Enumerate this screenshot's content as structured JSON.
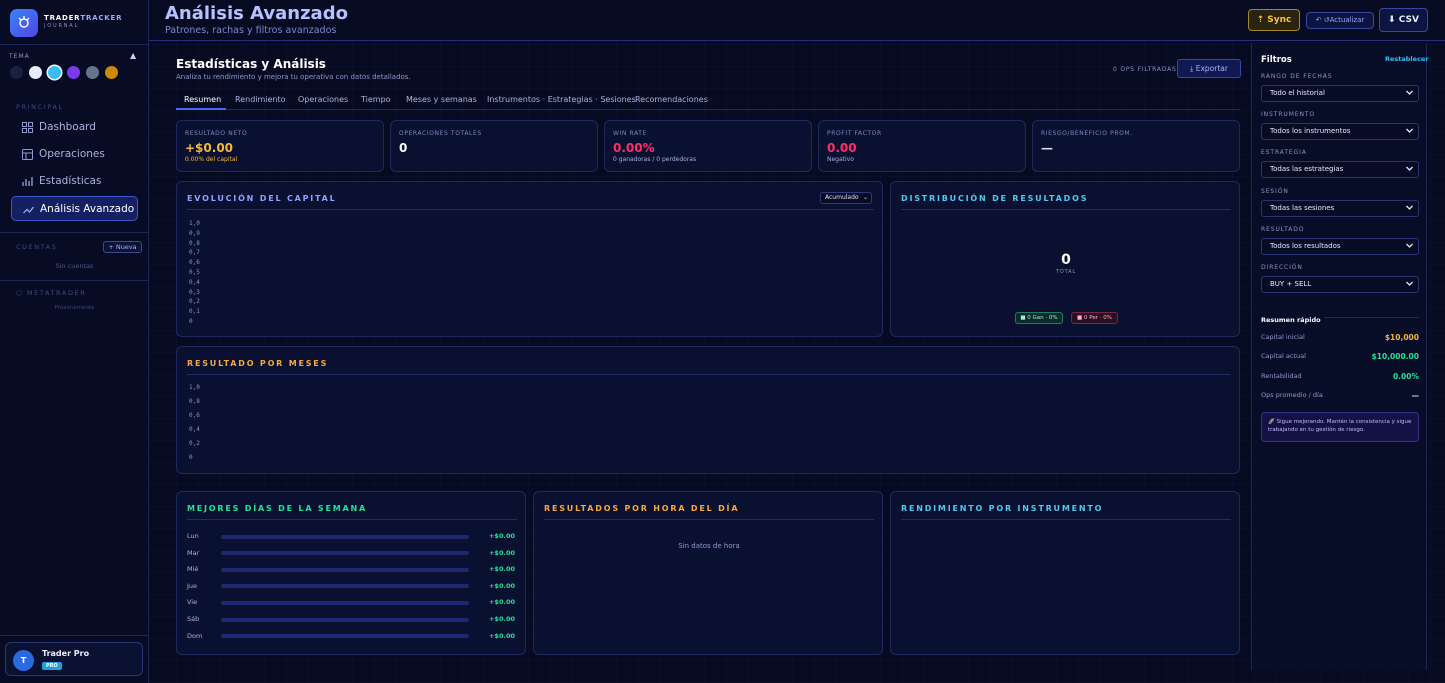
{
  "brand": {
    "name_part1": "TRADER",
    "name_part2": "TRACKER",
    "sub": "JOURNAL"
  },
  "theme": {
    "label": "TEMA",
    "swatches": [
      "#1a2040",
      "#e8ecfa",
      "#38bdf8",
      "#7c3aed",
      "#64748b",
      "#ca8a04"
    ]
  },
  "nav": {
    "section_label": "PRINCIPAL",
    "items": [
      {
        "label": "Dashboard",
        "icon": "grid-icon"
      },
      {
        "label": "Operaciones",
        "icon": "table-icon"
      },
      {
        "label": "Estadísticas",
        "icon": "bar-chart-icon"
      },
      {
        "label": "Análisis Avanzado",
        "icon": "trend-icon",
        "active": true
      }
    ]
  },
  "accounts": {
    "label": "CUENTAS",
    "new_button": "Nueva",
    "empty": "Sin cuentas"
  },
  "metatrader": {
    "label": "METATRADER",
    "sub": "Próximamente"
  },
  "user": {
    "initial": "T",
    "name": "Trader Pro",
    "badge": "PRO"
  },
  "header": {
    "title": "Análisis Avanzado",
    "subtitle": "Patrones, rachas y filtros avanzados",
    "sync": "Sync",
    "refresh": "Actualizar",
    "csv": "CSV"
  },
  "panel": {
    "title": "Estadísticas y Análisis",
    "subtitle": "Analiza tu rendimiento y mejora tu operativa con datos detallados.",
    "ops_filtered": "0 OPS FILTRADAS",
    "export": "Exportar"
  },
  "tabs": [
    "Resumen",
    "Rendimiento",
    "Operaciones",
    "Tiempo",
    "Meses y semanas",
    "Instrumentos · Estrategias · Sesiones",
    "Recomendaciones"
  ],
  "kpis": [
    {
      "label": "RESULTADO NETO",
      "value": "+$0.00",
      "sub": "0.00% del capital",
      "color": "#f5b73b",
      "subcolor": "#f5b73b"
    },
    {
      "label": "OPERACIONES TOTALES",
      "value": "0",
      "sub": "",
      "color": "#ffffff",
      "subcolor": "#8a93c2"
    },
    {
      "label": "WIN RATE",
      "value": "0.00%",
      "sub": "0 ganadoras / 0 perdedoras",
      "color": "#ff2d6b",
      "subcolor": "#a6b0de"
    },
    {
      "label": "PROFIT FACTOR",
      "value": "0.00",
      "sub": "Negativo",
      "color": "#ff2d6b",
      "subcolor": "#a6b0de"
    },
    {
      "label": "RIESGO/BENEFICIO PROM.",
      "value": "—",
      "sub": "",
      "color": "#d7dcf3",
      "subcolor": "#8a93c2"
    }
  ],
  "capital_chart": {
    "title": "EVOLUCIÓN DEL CAPITAL",
    "mode": "Acumulado",
    "yticks": [
      "1,0",
      "0,9",
      "0,8",
      "0,7",
      "0,6",
      "0,5",
      "0,4",
      "0,3",
      "0,2",
      "0,1",
      "0"
    ]
  },
  "distribution": {
    "title": "DISTRIBUCIÓN DE RESULTADOS",
    "total": "0",
    "total_label": "TOTAL",
    "win_legend": "0 Gan · 0%",
    "loss_legend": "0 Per · 0%"
  },
  "months_chart": {
    "title": "RESULTADO POR MESES",
    "yticks": [
      "1,0",
      "0,8",
      "0,6",
      "0,4",
      "0,2",
      "0"
    ]
  },
  "weekdays": {
    "title": "MEJORES DÍAS DE LA SEMANA",
    "days": [
      {
        "day": "Lun",
        "value": "+$0.00"
      },
      {
        "day": "Mar",
        "value": "+$0.00"
      },
      {
        "day": "Mié",
        "value": "+$0.00"
      },
      {
        "day": "Jue",
        "value": "+$0.00"
      },
      {
        "day": "Vie",
        "value": "+$0.00"
      },
      {
        "day": "Sáb",
        "value": "+$0.00"
      },
      {
        "day": "Dom",
        "value": "+$0.00"
      }
    ]
  },
  "hours": {
    "title": "RESULTADOS POR HORA DEL DÍA",
    "empty": "Sin datos de hora"
  },
  "instruments": {
    "title": "RENDIMIENTO POR INSTRUMENTO"
  },
  "filters": {
    "title": "Filtros",
    "reset": "Restablecer",
    "fields": [
      {
        "label": "RANGO DE FECHAS",
        "value": "Todo el historial"
      },
      {
        "label": "INSTRUMENTO",
        "value": "Todos los instrumentos"
      },
      {
        "label": "ESTRATEGIA",
        "value": "Todas las estrategias"
      },
      {
        "label": "SESIÓN",
        "value": "Todas las sesiones"
      },
      {
        "label": "RESULTADO",
        "value": "Todos los resultados"
      },
      {
        "label": "DIRECCIÓN",
        "value": "BUY + SELL"
      }
    ],
    "summary_title": "Resumen rápido",
    "summary": [
      {
        "label": "Capital inicial",
        "value": "$10,000",
        "color": "#f5b73b"
      },
      {
        "label": "Capital actual",
        "value": "$10,000.00",
        "color": "#22e29a"
      },
      {
        "label": "Rentabilidad",
        "value": "0.00%",
        "color": "#22e29a"
      },
      {
        "label": "Ops promedio / día",
        "value": "—",
        "color": "#d7dcf3"
      }
    ],
    "tip": "🚀 Sigue mejorando. Mantén la consistencia y sigue trabajando en tu gestión de riesgo."
  }
}
